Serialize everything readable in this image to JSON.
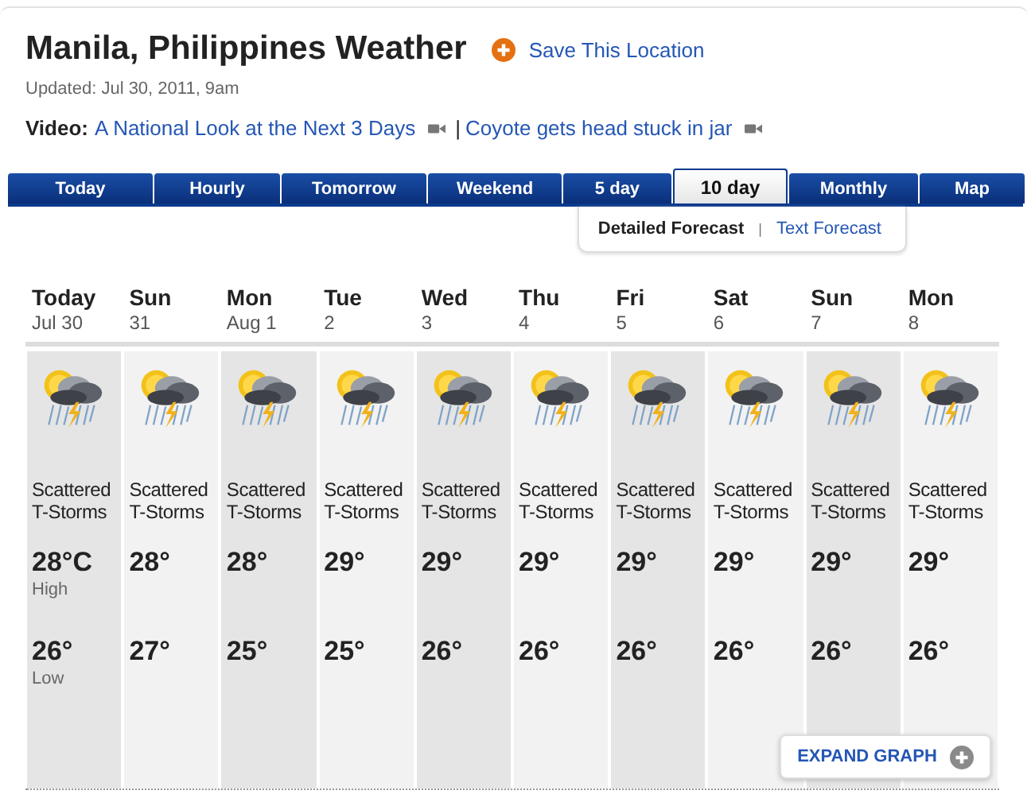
{
  "title": "Manila, Philippines Weather",
  "save_link": "Save This Location",
  "updated": "Updated: Jul 30, 2011, 9am",
  "video": {
    "label": "Video:",
    "links": [
      "A National Look at the Next 3 Days",
      "Coyote gets head stuck in jar"
    ],
    "separator": "|"
  },
  "tabs": [
    {
      "label": "Today",
      "selected": false
    },
    {
      "label": "Hourly",
      "selected": false
    },
    {
      "label": "Tomorrow",
      "selected": false
    },
    {
      "label": "Weekend",
      "selected": false
    },
    {
      "label": "5 day",
      "selected": false
    },
    {
      "label": "10 day",
      "selected": true
    },
    {
      "label": "Monthly",
      "selected": false
    },
    {
      "label": "Map",
      "selected": false
    }
  ],
  "subtabs": [
    {
      "label": "Detailed Forecast",
      "selected": true
    },
    {
      "label": "Text Forecast",
      "selected": false
    }
  ],
  "subtab_separator": "|",
  "days": [
    {
      "day": "Today",
      "date": "Jul 30",
      "condition": "Scattered T-Storms",
      "high": "28°C",
      "high_label": "High",
      "low": "26°",
      "low_label": "Low"
    },
    {
      "day": "Sun",
      "date": "31",
      "condition": "Scattered T-Storms",
      "high": "28°",
      "low": "27°"
    },
    {
      "day": "Mon",
      "date": "Aug 1",
      "condition": "Scattered T-Storms",
      "high": "28°",
      "low": "25°"
    },
    {
      "day": "Tue",
      "date": "2",
      "condition": "Scattered T-Storms",
      "high": "29°",
      "low": "25°"
    },
    {
      "day": "Wed",
      "date": "3",
      "condition": "Scattered T-Storms",
      "high": "29°",
      "low": "26°"
    },
    {
      "day": "Thu",
      "date": "4",
      "condition": "Scattered T-Storms",
      "high": "29°",
      "low": "26°"
    },
    {
      "day": "Fri",
      "date": "5",
      "condition": "Scattered T-Storms",
      "high": "29°",
      "low": "26°"
    },
    {
      "day": "Sat",
      "date": "6",
      "condition": "Scattered T-Storms",
      "high": "29°",
      "low": "26°"
    },
    {
      "day": "Sun",
      "date": "7",
      "condition": "Scattered T-Storms",
      "high": "29°",
      "low": "26°"
    },
    {
      "day": "Mon",
      "date": "8",
      "condition": "Scattered T-Storms",
      "high": "29°",
      "low": "26°"
    }
  ],
  "expand_button": "EXPAND GRAPH"
}
